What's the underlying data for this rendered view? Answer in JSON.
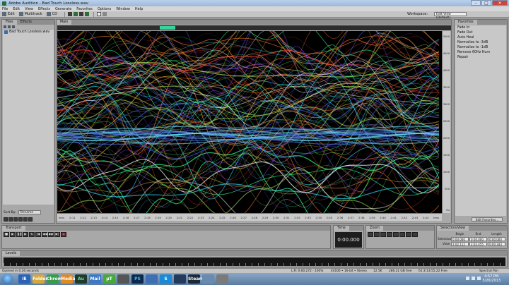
{
  "window": {
    "title": "Adobe Audition - Bad Touch Lossless.wav"
  },
  "menu": [
    "File",
    "Edit",
    "View",
    "Effects",
    "Generate",
    "Favorites",
    "Options",
    "Window",
    "Help"
  ],
  "toolbar": {
    "edit_label": "Edit",
    "multitrack_label": "Multitrack",
    "cd_label": "CD",
    "workspace_label": "Workspace:",
    "workspace_value": "Edit View (Default)"
  },
  "files_panel": {
    "tabs": [
      "Files",
      "Effects"
    ],
    "items": [
      "Bad Touch Lossless.wav"
    ],
    "sort_label": "Sort By:",
    "sort_value": "Filename"
  },
  "main_panel": {
    "tab": "Main",
    "time_ticks": [
      "hms",
      "2:11",
      "2:12",
      "2:13",
      "2:14",
      "2:15",
      "2:16",
      "2:17",
      "2:18",
      "2:19",
      "2:20",
      "2:21",
      "2:22",
      "2:23",
      "2:24",
      "2:25",
      "2:26",
      "2:27",
      "2:28",
      "2:29",
      "2:30",
      "2:31",
      "2:32",
      "2:33",
      "2:34",
      "2:35",
      "2:36",
      "2:37",
      "2:38",
      "2:39",
      "2:40",
      "2:41",
      "2:42",
      "2:43",
      "2:44",
      "hms"
    ],
    "freq_ticks": [
      "5000",
      "4500",
      "4000",
      "3500",
      "3000",
      "2500",
      "2000",
      "1500",
      "1000",
      "500"
    ],
    "freq_unit": "Hz"
  },
  "favorites_panel": {
    "tab": "Favorites",
    "items": [
      "Fade In",
      "Fade Out",
      "Auto Heal",
      "Normalize to -3dB",
      "Normalize to -1dB",
      "Remove 60Hz Hum",
      "Repair"
    ],
    "edit_button": "Edit Favorites..."
  },
  "transport": {
    "tab": "Transport"
  },
  "time": {
    "tab": "Time",
    "value": "0:00.000"
  },
  "zoom": {
    "tab": "Zoom"
  },
  "selection": {
    "tab": "Selection/View",
    "headers": [
      "Begin",
      "End",
      "Length"
    ],
    "rows": [
      {
        "label": "Selection",
        "values": [
          "0:00.000",
          "0:00.000",
          "0:00.000"
        ]
      },
      {
        "label": "View",
        "values": [
          "2:02.112",
          "2:02.455",
          "0:00.343"
        ]
      }
    ]
  },
  "levels": {
    "tab": "Levels"
  },
  "status": {
    "left": "Opened in 0.26 seconds",
    "right_items": [
      "L:R: 0:00.272 - 100%",
      "44100 • 16-bit • Stereo",
      "12.5K",
      "286.21 GB free",
      "61:3:13:55.22 Free",
      "Spectral Pan"
    ]
  },
  "taskbar": {
    "apps": [
      "IE",
      "Folder",
      "Chrome",
      "Media",
      "Au",
      "Mail",
      "μT",
      "",
      "PS",
      "",
      "S",
      "",
      "Steam",
      "",
      ""
    ],
    "time": "4:57 PM",
    "date": "5/26/2013"
  },
  "colors": {
    "overview_handle": "#35d59a",
    "spectral_bg": "#000000"
  }
}
